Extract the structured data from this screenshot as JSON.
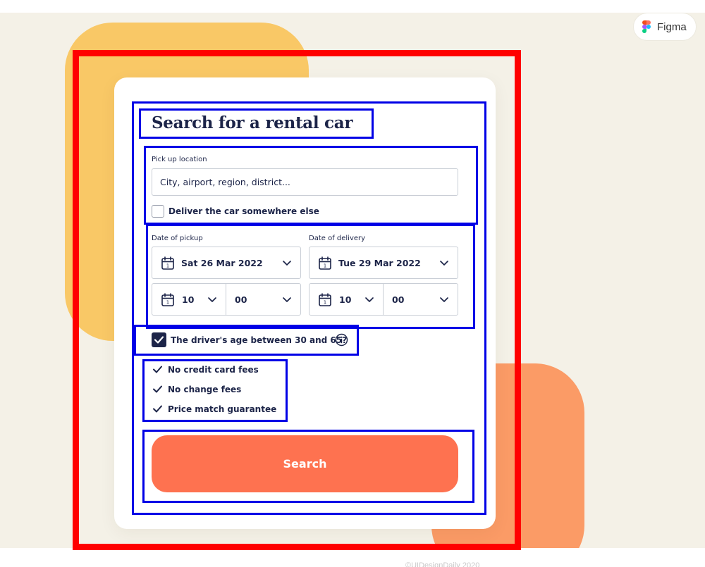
{
  "figma_badge": {
    "label": "Figma",
    "icon": "figma-logo-icon"
  },
  "card": {
    "title": "Search for a rental car",
    "pickup_location": {
      "label": "Pick up location",
      "placeholder": "City, airport, region, district..."
    },
    "deliver_elsewhere": {
      "label": "Deliver the car somewhere else",
      "checked": false
    },
    "pickup": {
      "label": "Date of pickup",
      "date": "Sat 26 Mar 2022",
      "hour": "10",
      "minute": "00"
    },
    "delivery": {
      "label": "Date of delivery",
      "date": "Tue 29 Mar 2022",
      "hour": "10",
      "minute": "00"
    },
    "driver_age": {
      "label": "The driver's age between 30 and 65?",
      "checked": true,
      "icon": "info-icon"
    },
    "perks": [
      "No credit card fees",
      "No change fees",
      "Price match guarantee"
    ],
    "search_label": "Search"
  },
  "footer": {
    "copyright": "©UIDesignDaily 2020"
  },
  "colors": {
    "background": "#f4f1e7",
    "navy": "#1c2448",
    "accent": "#fe7250",
    "yellow_blob": "#f9c866",
    "orange_blob": "#fb9b66",
    "annotation_red": "#ff0000",
    "annotation_blue": "#0000e6"
  }
}
